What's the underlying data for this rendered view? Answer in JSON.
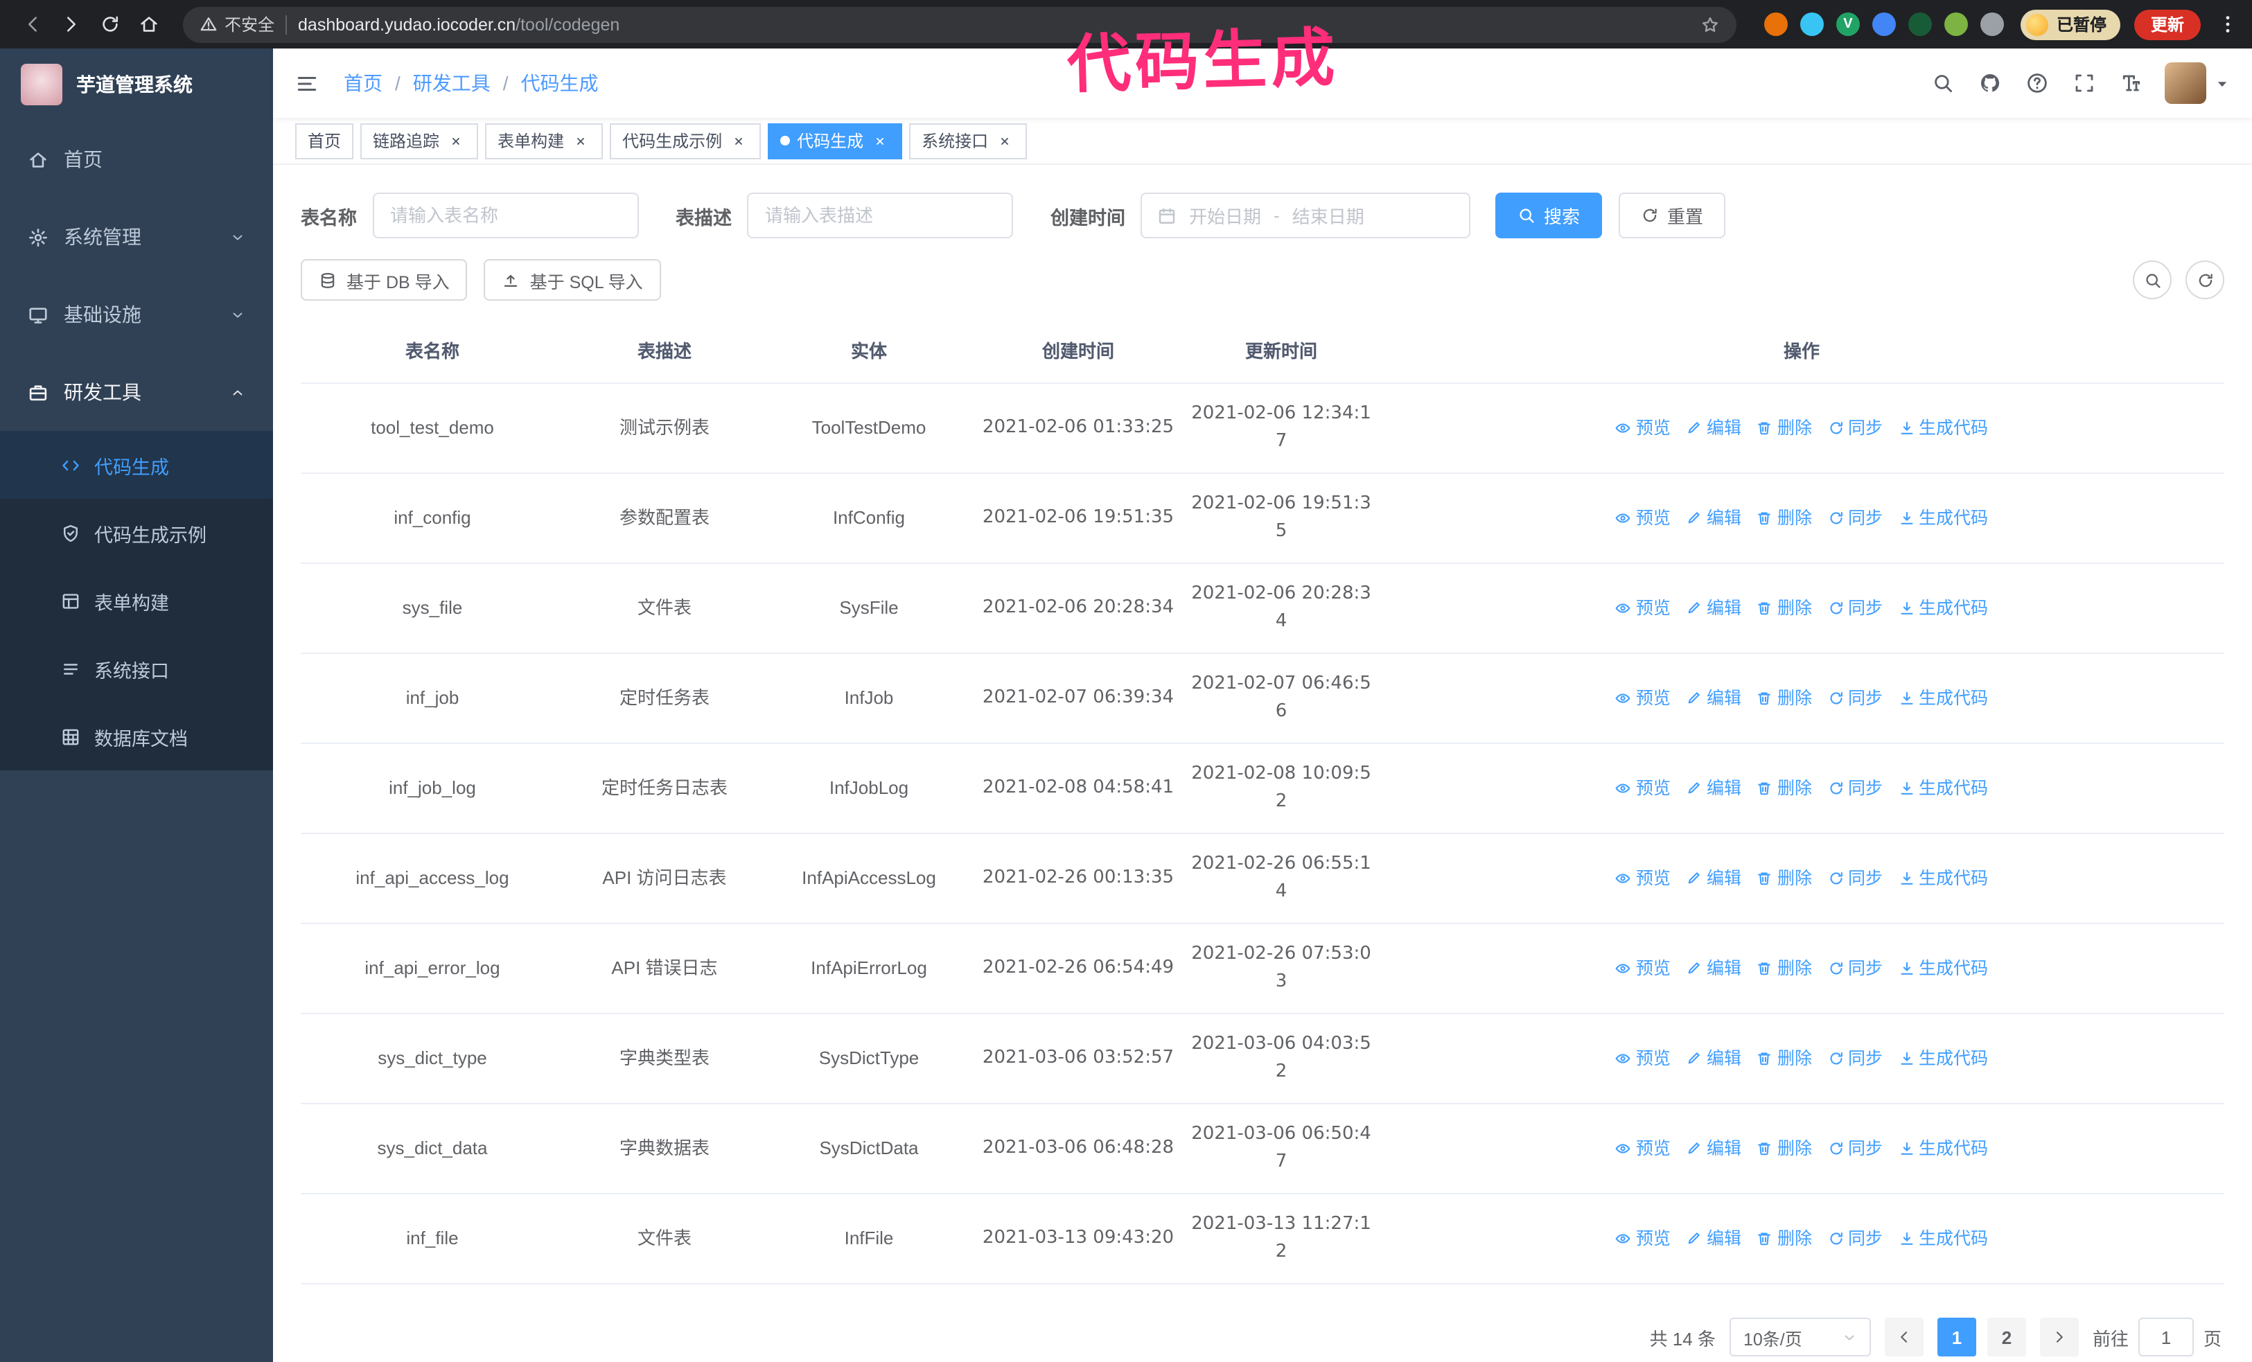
{
  "colors": {
    "primary": "#409eff",
    "sidebar-bg": "#304156",
    "sidebar-sub-bg": "#1f2d3d",
    "chrome-bg": "#202124",
    "annotation": "#ff2d7a",
    "update-button-bg": "#d93025",
    "paused-badge-bg": "#e8d8ae"
  },
  "browser": {
    "nav_icons": [
      "back-icon",
      "forward-icon",
      "reload-icon",
      "home-icon"
    ],
    "security_label": "不安全",
    "url_domain": "dashboard.yudao.iocoder.cn",
    "url_path": "/tool/codegen",
    "extensions": [
      {
        "name": "fox-extension-icon",
        "color": "#e8710a",
        "glyph": ""
      },
      {
        "name": "drop-extension-icon",
        "color": "#39c5f3",
        "glyph": ""
      },
      {
        "name": "v-extension-icon",
        "color": "#21a366",
        "glyph": "V"
      },
      {
        "name": "people-extension-icon",
        "color": "#4285f4",
        "glyph": ""
      },
      {
        "name": "chart-extension-icon",
        "color": "#185c37",
        "glyph": ""
      },
      {
        "name": "leaf-extension-icon",
        "color": "#7cb342",
        "glyph": ""
      },
      {
        "name": "puzzle-extension-icon",
        "color": "#9aa0a6",
        "glyph": ""
      }
    ],
    "paused_badge": "已暂停",
    "update_button": "更新"
  },
  "annotation": {
    "text": "代码生成"
  },
  "sidebar": {
    "logo_title": "芋道管理系统",
    "items": [
      {
        "key": "home",
        "label": "首页",
        "icon": "home-icon"
      },
      {
        "key": "system",
        "label": "系统管理",
        "icon": "gear-icon",
        "chevron": "down"
      },
      {
        "key": "infrastructure",
        "label": "基础设施",
        "icon": "monitor-icon",
        "chevron": "down"
      },
      {
        "key": "devtools",
        "label": "研发工具",
        "icon": "briefcase-icon",
        "chevron": "up",
        "expanded": true
      }
    ],
    "subitems": [
      {
        "key": "codegen",
        "label": "代码生成",
        "icon": "code-icon",
        "active": true
      },
      {
        "key": "codegen-example",
        "label": "代码生成示例",
        "icon": "shield-icon"
      },
      {
        "key": "form-builder",
        "label": "表单构建",
        "icon": "form-icon"
      },
      {
        "key": "system-api",
        "label": "系统接口",
        "icon": "api-icon"
      },
      {
        "key": "db-doc",
        "label": "数据库文档",
        "icon": "grid-icon"
      }
    ]
  },
  "header": {
    "breadcrumb": [
      "首页",
      "研发工具",
      "代码生成"
    ],
    "breadcrumb_separator": "/",
    "icons": [
      "search-icon",
      "github-icon",
      "help-icon",
      "fullscreen-icon",
      "font-size-icon"
    ]
  },
  "tabs": [
    {
      "key": "home",
      "label": "首页",
      "closable": false
    },
    {
      "key": "tracing",
      "label": "链路追踪",
      "closable": true
    },
    {
      "key": "form-builder",
      "label": "表单构建",
      "closable": true
    },
    {
      "key": "codegen-example",
      "label": "代码生成示例",
      "closable": true
    },
    {
      "key": "codegen",
      "label": "代码生成",
      "closable": true,
      "active": true
    },
    {
      "key": "system-api",
      "label": "系统接口",
      "closable": true
    }
  ],
  "filters": {
    "table_name_label": "表名称",
    "table_name_placeholder": "请输入表名称",
    "table_desc_label": "表描述",
    "table_desc_placeholder": "请输入表描述",
    "create_time_label": "创建时间",
    "date_start_placeholder": "开始日期",
    "date_separator": "-",
    "date_end_placeholder": "结束日期",
    "search_button": "搜索",
    "reset_button": "重置"
  },
  "toolbar": {
    "import_db_button": "基于 DB 导入",
    "import_sql_button": "基于 SQL 导入"
  },
  "table": {
    "columns": [
      "表名称",
      "表描述",
      "实体",
      "创建时间",
      "更新时间",
      "操作"
    ],
    "actions": [
      {
        "key": "preview",
        "label": "预览",
        "icon": "eye-icon"
      },
      {
        "key": "edit",
        "label": "编辑",
        "icon": "edit-icon"
      },
      {
        "key": "delete",
        "label": "删除",
        "icon": "delete-icon"
      },
      {
        "key": "sync",
        "label": "同步",
        "icon": "sync-icon"
      },
      {
        "key": "generate",
        "label": "生成代码",
        "icon": "download-icon"
      }
    ],
    "rows": [
      {
        "name": "tool_test_demo",
        "desc": "测试示例表",
        "entity": "ToolTestDemo",
        "created": "2021-02-06 01:33:25",
        "updated": "2021-02-06 12:34:17"
      },
      {
        "name": "inf_config",
        "desc": "参数配置表",
        "entity": "InfConfig",
        "created": "2021-02-06 19:51:35",
        "updated": "2021-02-06 19:51:35"
      },
      {
        "name": "sys_file",
        "desc": "文件表",
        "entity": "SysFile",
        "created": "2021-02-06 20:28:34",
        "updated": "2021-02-06 20:28:34"
      },
      {
        "name": "inf_job",
        "desc": "定时任务表",
        "entity": "InfJob",
        "created": "2021-02-07 06:39:34",
        "updated": "2021-02-07 06:46:56"
      },
      {
        "name": "inf_job_log",
        "desc": "定时任务日志表",
        "entity": "InfJobLog",
        "created": "2021-02-08 04:58:41",
        "updated": "2021-02-08 10:09:52"
      },
      {
        "name": "inf_api_access_log",
        "desc": "API 访问日志表",
        "entity": "InfApiAccessLog",
        "created": "2021-02-26 00:13:35",
        "updated": "2021-02-26 06:55:14"
      },
      {
        "name": "inf_api_error_log",
        "desc": "API 错误日志",
        "entity": "InfApiErrorLog",
        "created": "2021-02-26 06:54:49",
        "updated": "2021-02-26 07:53:03"
      },
      {
        "name": "sys_dict_type",
        "desc": "字典类型表",
        "entity": "SysDictType",
        "created": "2021-03-06 03:52:57",
        "updated": "2021-03-06 04:03:52"
      },
      {
        "name": "sys_dict_data",
        "desc": "字典数据表",
        "entity": "SysDictData",
        "created": "2021-03-06 06:48:28",
        "updated": "2021-03-06 06:50:47"
      },
      {
        "name": "inf_file",
        "desc": "文件表",
        "entity": "InfFile",
        "created": "2021-03-13 09:43:20",
        "updated": "2021-03-13 11:27:12"
      }
    ]
  },
  "pagination": {
    "total_text": "共 14 条",
    "page_size": "10条/页",
    "pages": [
      {
        "label": "1",
        "active": true
      },
      {
        "label": "2"
      }
    ],
    "goto_label": "前往",
    "goto_value": "1",
    "goto_suffix": "页"
  }
}
